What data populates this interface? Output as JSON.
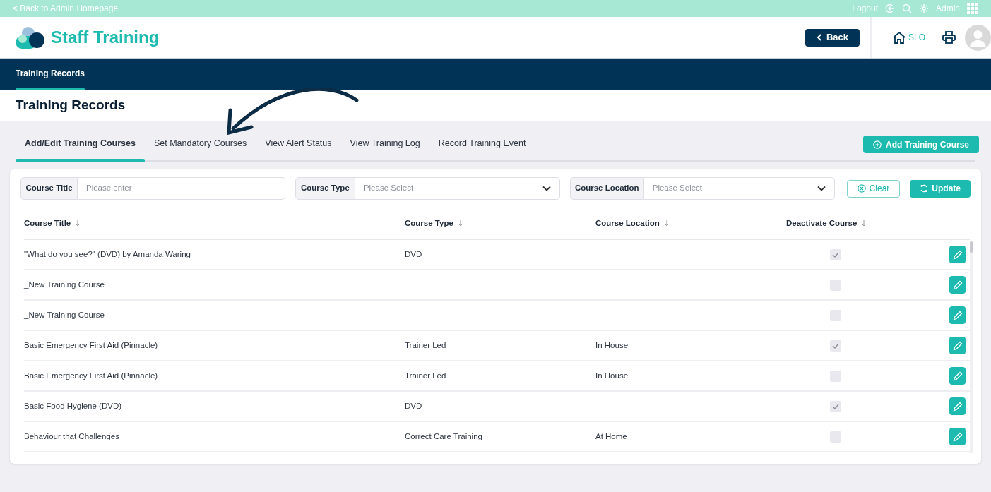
{
  "top_bar": {
    "back_link": "< Back to Admin Homepage",
    "logout": "Logout",
    "user": "Admin"
  },
  "header": {
    "app_name": "Staff Training",
    "back_button": "Back",
    "home_label": "SLO"
  },
  "nav": {
    "items": [
      {
        "label": "Training Records",
        "selected": true
      }
    ]
  },
  "page_title": "Training Records",
  "tabs": [
    {
      "label": "Add/Edit Training Courses",
      "selected": true
    },
    {
      "label": "Set Mandatory Courses",
      "selected": false
    },
    {
      "label": "View Alert Status",
      "selected": false
    },
    {
      "label": "View Training Log",
      "selected": false
    },
    {
      "label": "Record Training Event",
      "selected": false
    }
  ],
  "add_button": "Add Training Course",
  "filters": [
    {
      "label": "Course Title",
      "kind": "text",
      "placeholder": "Please enter"
    },
    {
      "label": "Course Type",
      "kind": "select",
      "placeholder": "Please Select"
    },
    {
      "label": "Course Location",
      "kind": "select",
      "placeholder": "Please Select"
    }
  ],
  "clear_button": "Clear",
  "update_button": "Update",
  "table": {
    "columns": [
      "Course Title",
      "Course Type",
      "Course Location",
      "Deactivate Course"
    ],
    "rows": [
      {
        "title": "\"What do you see?\" (DVD) by Amanda Waring",
        "type": "DVD",
        "location": "",
        "deactivated": true
      },
      {
        "title": "_New Training Course",
        "type": "",
        "location": "",
        "deactivated": false
      },
      {
        "title": "_New Training Course",
        "type": "",
        "location": "",
        "deactivated": false
      },
      {
        "title": "Basic Emergency First Aid (Pinnacle)",
        "type": "Trainer Led",
        "location": "In House",
        "deactivated": true
      },
      {
        "title": "Basic Emergency First Aid (Pinnacle)",
        "type": "Trainer Led",
        "location": "In House",
        "deactivated": false
      },
      {
        "title": "Basic Food Hygiene (DVD)",
        "type": "DVD",
        "location": "",
        "deactivated": true
      },
      {
        "title": "Behaviour that Challenges",
        "type": "Correct Care Training",
        "location": "At Home",
        "deactivated": false
      }
    ]
  }
}
